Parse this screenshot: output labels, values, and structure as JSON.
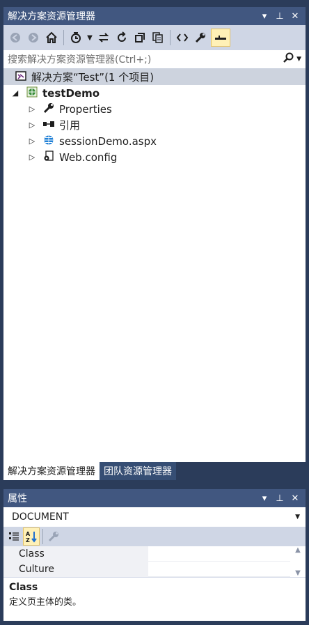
{
  "solution_explorer": {
    "title": "解决方案资源管理器",
    "controls": {
      "dropdown": "▾",
      "pin": "⊥",
      "close": "✕"
    },
    "search_placeholder": "搜索解决方案资源管理器(Ctrl+;)",
    "search_icon": "⌕",
    "solution_label": "解决方案“Test”(1 个项目)",
    "project_label": "testDemo",
    "items": [
      {
        "label": "Properties",
        "icon": "wrench-icon"
      },
      {
        "label": "引用",
        "icon": "references-icon"
      },
      {
        "label": "sessionDemo.aspx",
        "icon": "web-page-icon"
      },
      {
        "label": "Web.config",
        "icon": "config-icon"
      }
    ]
  },
  "tabs": [
    {
      "label": "解决方案资源管理器",
      "active": true
    },
    {
      "label": "团队资源管理器",
      "active": false
    }
  ],
  "properties": {
    "title": "属性",
    "object": "DOCUMENT",
    "rows": [
      {
        "name": "Class",
        "value": ""
      },
      {
        "name": "Culture",
        "value": ""
      }
    ],
    "desc_title": "Class",
    "desc_text": "定义页主体的类。"
  },
  "colors": {
    "accent": "#415780",
    "toolbar": "#cfd6e5",
    "selection": "#cdd3de",
    "highlight": "#fff1b7"
  }
}
